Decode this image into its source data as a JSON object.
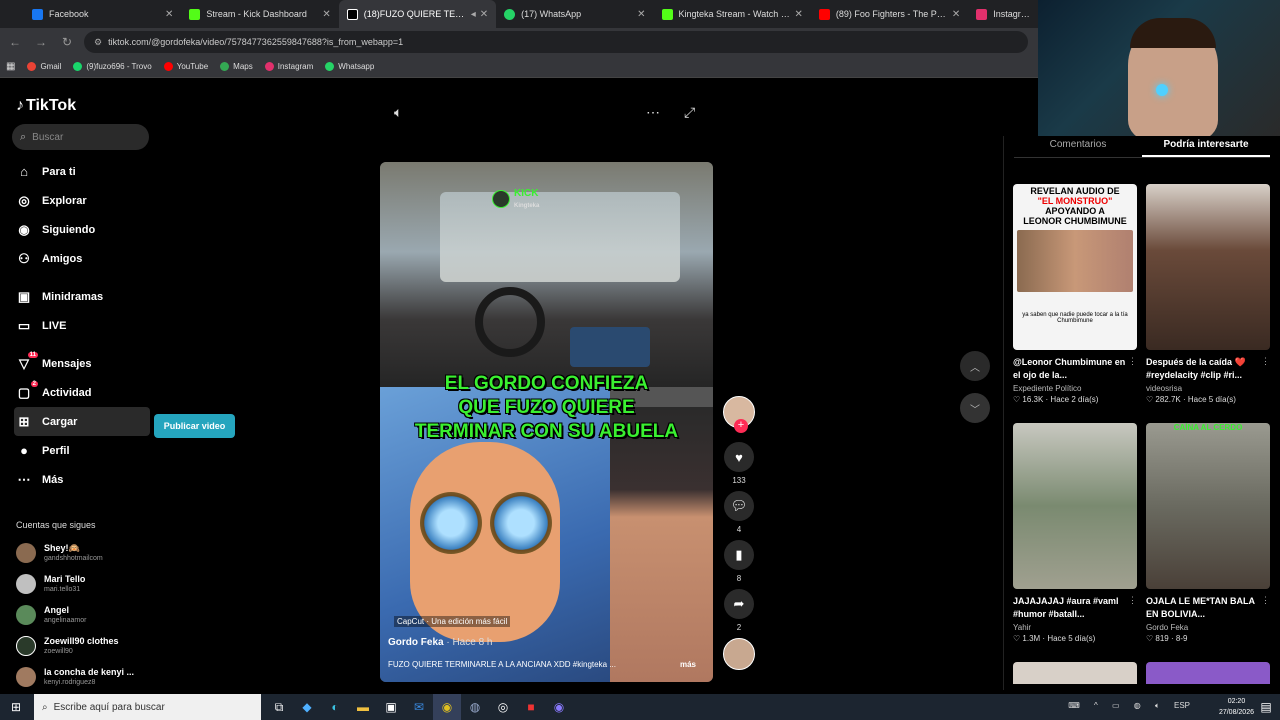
{
  "browser": {
    "tabs": [
      {
        "label": "Facebook",
        "color": "#1877f2",
        "active": false
      },
      {
        "label": "Stream - Kick Dashboard",
        "color": "#53fc18",
        "active": false
      },
      {
        "label": "(18)FUZO QUIERE TERMINA",
        "color": "#000000",
        "active": true
      },
      {
        "label": "(17) WhatsApp",
        "color": "#25d366",
        "active": false
      },
      {
        "label": "Kingteka Stream - Watch Live o",
        "color": "#53fc18",
        "active": false
      },
      {
        "label": "(89) Foo Fighters - The Pretend",
        "color": "#ff0000",
        "active": false
      },
      {
        "label": "Instagram",
        "color": "#e1306c",
        "active": false
      }
    ],
    "url": "tiktok.com/@gordofeka/video/7578477362559847688?is_from_webapp=1",
    "bookmarks": [
      {
        "label": "Gmail",
        "color": "#ea4335"
      },
      {
        "label": "(9)fuzo696 - Trovo",
        "color": "#19d66b"
      },
      {
        "label": "YouTube",
        "color": "#ff0000"
      },
      {
        "label": "Maps",
        "color": "#34a853"
      },
      {
        "label": "Instagram",
        "color": "#e1306c"
      },
      {
        "label": "Whatsapp",
        "color": "#25d366"
      }
    ]
  },
  "tiktok": {
    "logo": "TikTok",
    "search_placeholder": "Buscar",
    "nav": [
      {
        "label": "Para ti",
        "icon": "home-icon",
        "glyph": "⌂",
        "badge": ""
      },
      {
        "label": "Explorar",
        "icon": "compass-icon",
        "glyph": "◎",
        "badge": ""
      },
      {
        "label": "Siguiendo",
        "icon": "following-icon",
        "glyph": "◉",
        "badge": ""
      },
      {
        "label": "Amigos",
        "icon": "friends-icon",
        "glyph": "⚇",
        "badge": ""
      },
      {
        "label": "Minidramas",
        "icon": "minidramas-icon",
        "glyph": "▣",
        "badge": ""
      },
      {
        "label": "LIVE",
        "icon": "live-icon",
        "glyph": "▭",
        "badge": ""
      },
      {
        "label": "Mensajes",
        "icon": "messages-icon",
        "glyph": "▽",
        "badge": "11"
      },
      {
        "label": "Actividad",
        "icon": "activity-icon",
        "glyph": "▢",
        "badge": "2"
      },
      {
        "label": "Cargar",
        "icon": "upload-icon",
        "glyph": "⊞",
        "badge": ""
      },
      {
        "label": "Perfil",
        "icon": "profile-icon",
        "glyph": "●",
        "badge": ""
      },
      {
        "label": "Más",
        "icon": "more-icon",
        "glyph": "⋯",
        "badge": ""
      }
    ],
    "publish_label": "Publicar video",
    "following_header": "Cuentas que sigues",
    "following": [
      {
        "name": "Shey!🙉",
        "user": "gandshhotmailcom",
        "color": "#8a6a50"
      },
      {
        "name": "Mari Tello",
        "user": "mari.tello31",
        "color": "#c0c0c0"
      },
      {
        "name": "Angel",
        "user": "angelinaamor",
        "color": "#5a8a5a"
      },
      {
        "name": "Zoewill90 clothes",
        "user": "zoewill90",
        "color": "#2a3a2a"
      },
      {
        "name": "la concha de kenyi ...",
        "user": "kenyi.rodriguez8",
        "color": "#a07a60"
      }
    ],
    "video": {
      "overlay_text": [
        "EL GORDO CONFIEZA",
        "QUE FUZO QUIERE",
        "TERMINAR CON SU ABUELA"
      ],
      "kick_label": "KICK",
      "kick_sub": "Kingteka",
      "capcut": "CapCut · Una edición más fácil",
      "author": "Gordo Feka",
      "time": " · Hace 8 h",
      "description": "FUZO QUIERE TERMINARLE A LA ANCIANA XDD #kingteka ...",
      "more": "más"
    },
    "actions": {
      "likes": "133",
      "comments": "4",
      "saves": "8",
      "shares": "2"
    },
    "right_tabs": [
      "Comentarios",
      "Podría interesarte"
    ],
    "cards": [
      {
        "title": "@Leonor Chumbimune en el ojo de la...",
        "author": "Expediente Político",
        "views": "16.3K",
        "time": "Hace 2 día(s)",
        "color": "#f4f4f4",
        "thumb_text": [
          "REVELAN AUDIO DE",
          "\"EL MONSTRUO\"",
          "APOYANDO A",
          "LEONOR CHUMBIMUNE"
        ],
        "thumb_caption": "ya saben que nadie puede tocar a la tía Chumbimune"
      },
      {
        "title": "Después de la caída ❤️ #reydelacity #clip #ri...",
        "author": "videosrisa",
        "views": "282.7K",
        "time": "Hace 5 día(s)",
        "color": "#5a4030",
        "thumb_text": [],
        "thumb_caption": ""
      },
      {
        "title": "JAJAJAJAJ #aura #vaml #humor #batall...",
        "author": "Yahir",
        "views": "1.3M",
        "time": "Hace 5 día(s)",
        "color": "#7a8a70",
        "thumb_text": [],
        "thumb_caption": ""
      },
      {
        "title": "OJALA LE ME*TAN BALA EN BOLIVIA...",
        "author": "Gordo Feka",
        "views": "819",
        "time": "8-9",
        "color": "#6a6a60",
        "thumb_text": [
          "CAÍNA AL CERDO"
        ],
        "thumb_caption": ""
      }
    ]
  },
  "taskbar": {
    "search_placeholder": "Escribe aquí para buscar",
    "time": "02:20",
    "date": "27/08/2026",
    "lang": "ESP"
  }
}
